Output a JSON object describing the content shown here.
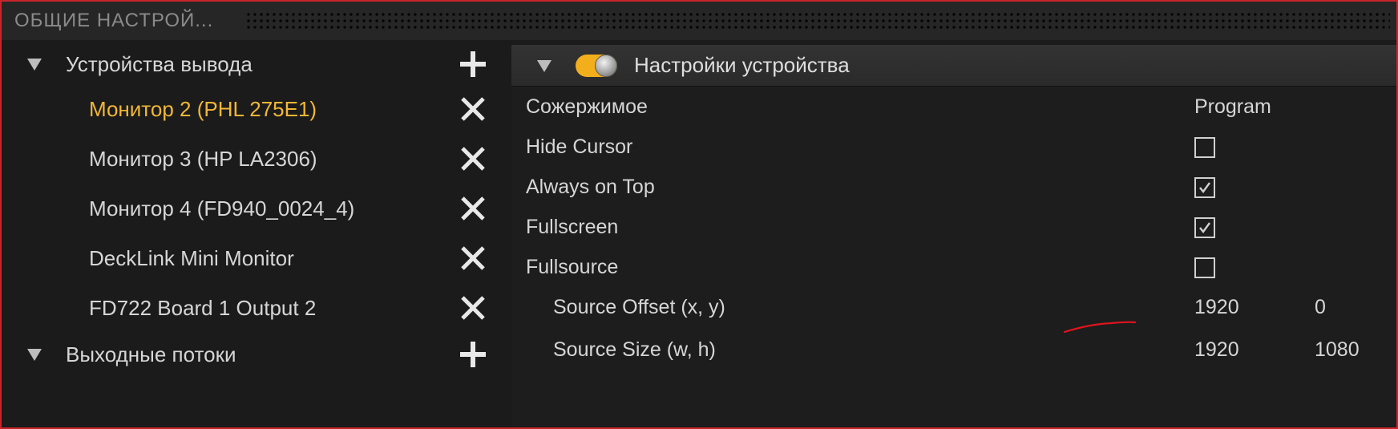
{
  "window": {
    "title": "ОБЩИЕ НАСТРОЙ..."
  },
  "outputs_tree": {
    "groups": [
      {
        "label": "Устройства вывода",
        "items": [
          {
            "label": "Монитор 2 (PHL 275E1)",
            "active": true
          },
          {
            "label": "Монитор 3 (HP LA2306)",
            "active": false
          },
          {
            "label": "Монитор 4 (FD940_0024_4)",
            "active": false
          },
          {
            "label": "DeckLink Mini Monitor",
            "active": false
          },
          {
            "label": "FD722 Board 1 Output 2",
            "active": false
          }
        ]
      },
      {
        "label": "Выходные потоки",
        "items": []
      }
    ],
    "icons": {
      "expand": "triangle-down-icon",
      "add": "plus-icon",
      "remove": "close-icon"
    }
  },
  "device_settings": {
    "title": "Настройки устройства",
    "enabled": true,
    "accent_color": "#f3ae1c",
    "active_item_color": "#f2b736",
    "rows": [
      {
        "label": "Сожержимое",
        "value": "Program"
      },
      {
        "label": "Hide Cursor",
        "checked": false
      },
      {
        "label": "Always on Top",
        "checked": true
      },
      {
        "label": "Fullscreen",
        "checked": true
      },
      {
        "label": "Fullsource",
        "checked": false
      },
      {
        "label": "Source Offset (x, y)",
        "x": "1920",
        "y": "0"
      },
      {
        "label": "Source Size (w, h)",
        "w": "1920",
        "h": "1080"
      }
    ]
  }
}
